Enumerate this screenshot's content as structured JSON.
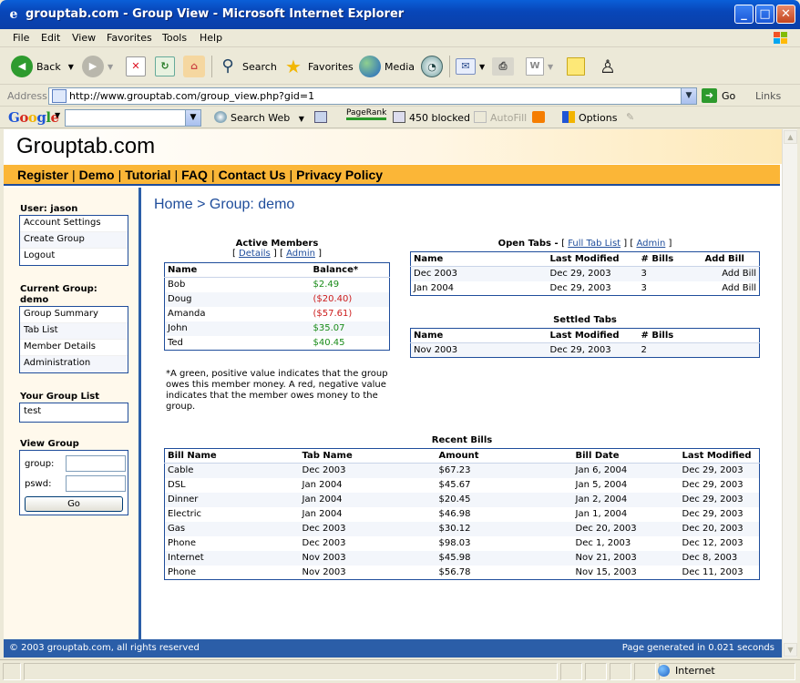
{
  "window": {
    "title": "grouptab.com - Group View - Microsoft Internet Explorer",
    "minimize": "_",
    "maximize": "□",
    "close": "✕"
  },
  "menu": [
    "File",
    "Edit",
    "View",
    "Favorites",
    "Tools",
    "Help"
  ],
  "toolbar": {
    "back": "Back",
    "search": "Search",
    "favorites": "Favorites",
    "media": "Media"
  },
  "address": {
    "label": "Address",
    "url": "http://www.grouptab.com/group_view.php?gid=1",
    "go": "Go",
    "links": "Links"
  },
  "googlebar": {
    "logo": "Google",
    "search_web": "Search Web",
    "pagerank": "PageRank",
    "blocked": "450 blocked",
    "autofill": "AutoFill",
    "options": "Options"
  },
  "site": {
    "brand": "Grouptab.com",
    "nav": [
      "Register",
      "Demo",
      "Tutorial",
      "FAQ",
      "Contact Us",
      "Privacy Policy"
    ],
    "footer_left": "© 2003 grouptab.com, all rights reserved",
    "footer_right": "Page generated in 0.021 seconds"
  },
  "sidebar": {
    "user_heading": "User: jason",
    "user_links": [
      "Account Settings",
      "Create Group",
      "Logout"
    ],
    "group_heading_1": "Current Group:",
    "group_heading_2": "demo",
    "group_links": [
      "Group Summary",
      "Tab List",
      "Member Details",
      "Administration"
    ],
    "list_heading": "Your Group List",
    "groups": [
      "test"
    ],
    "view_heading": "View Group",
    "group_label": "group:",
    "pswd_label": "pswd:",
    "go": "Go"
  },
  "main": {
    "breadcrumb": "Home > Group: demo",
    "members": {
      "title": "Active Members",
      "details_link": "Details",
      "admin_link": "Admin",
      "col_name": "Name",
      "col_balance": "Balance*",
      "rows": [
        {
          "name": "Bob",
          "balance": "$2.49",
          "positive": true
        },
        {
          "name": "Doug",
          "balance": "($20.40)",
          "positive": false
        },
        {
          "name": "Amanda",
          "balance": "($57.61)",
          "positive": false
        },
        {
          "name": "John",
          "balance": "$35.07",
          "positive": true
        },
        {
          "name": "Ted",
          "balance": "$40.45",
          "positive": true
        }
      ]
    },
    "note": "*A green, positive value indicates that the group owes this member money. A red, negative value indicates that the member owes money to the group.",
    "open_tabs": {
      "title": "Open Tabs - ",
      "full_link": "Full Tab List",
      "admin_link": "Admin",
      "cols": [
        "Name",
        "Last Modified",
        "# Bills",
        "Add Bill"
      ],
      "rows": [
        [
          "Dec 2003",
          "Dec 29, 2003",
          "3",
          "Add Bill"
        ],
        [
          "Jan 2004",
          "Dec 29, 2003",
          "3",
          "Add Bill"
        ]
      ]
    },
    "settled_tabs": {
      "title": "Settled Tabs",
      "cols": [
        "Name",
        "Last Modified",
        "# Bills"
      ],
      "rows": [
        [
          "Nov 2003",
          "Dec 29, 2003",
          "2"
        ]
      ]
    },
    "recent_bills": {
      "title": "Recent Bills",
      "cols": [
        "Bill Name",
        "Tab Name",
        "Amount",
        "Bill Date",
        "Last Modified"
      ],
      "rows": [
        [
          "Cable",
          "Dec 2003",
          "$67.23",
          "Jan 6, 2004",
          "Dec 29, 2003"
        ],
        [
          "DSL",
          "Jan 2004",
          "$45.67",
          "Jan 5, 2004",
          "Dec 29, 2003"
        ],
        [
          "Dinner",
          "Jan 2004",
          "$20.45",
          "Jan 2, 2004",
          "Dec 29, 2003"
        ],
        [
          "Electric",
          "Jan 2004",
          "$46.98",
          "Jan 1, 2004",
          "Dec 29, 2003"
        ],
        [
          "Gas",
          "Dec 2003",
          "$30.12",
          "Dec 20, 2003",
          "Dec 20, 2003"
        ],
        [
          "Phone",
          "Dec 2003",
          "$98.03",
          "Dec 1, 2003",
          "Dec 12, 2003"
        ],
        [
          "Internet",
          "Nov 2003",
          "$45.98",
          "Nov 21, 2003",
          "Dec 8, 2003"
        ],
        [
          "Phone",
          "Nov 2003",
          "$56.78",
          "Nov 15, 2003",
          "Dec 11, 2003"
        ]
      ]
    }
  },
  "status": {
    "zone": "Internet"
  },
  "colors": {
    "accent_blue": "#1f4d9b",
    "nav_orange": "#fbb637",
    "positive": "#1a8c1a",
    "negative": "#cc1b1b"
  }
}
